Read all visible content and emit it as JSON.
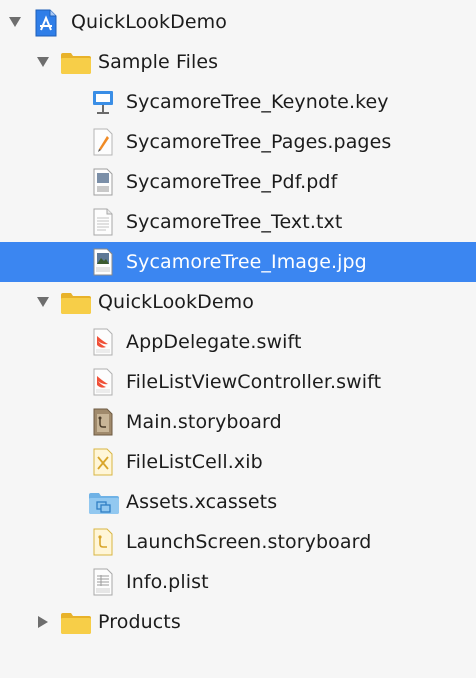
{
  "project": {
    "name": "QuickLookDemo",
    "icon": "xcode-project-icon",
    "expanded": true
  },
  "groups": [
    {
      "name": "Sample Files",
      "icon": "folder-icon",
      "expanded": true,
      "files": [
        {
          "name": "SycamoreTree_Keynote.key",
          "icon": "keynote-file-icon"
        },
        {
          "name": "SycamoreTree_Pages.pages",
          "icon": "pages-file-icon"
        },
        {
          "name": "SycamoreTree_Pdf.pdf",
          "icon": "pdf-file-icon"
        },
        {
          "name": "SycamoreTree_Text.txt",
          "icon": "text-file-icon"
        },
        {
          "name": "SycamoreTree_Image.jpg",
          "icon": "jpeg-file-icon",
          "selected": true
        }
      ]
    },
    {
      "name": "QuickLookDemo",
      "icon": "folder-icon",
      "expanded": true,
      "files": [
        {
          "name": "AppDelegate.swift",
          "icon": "swift-file-icon"
        },
        {
          "name": "FileListViewController.swift",
          "icon": "swift-file-icon"
        },
        {
          "name": "Main.storyboard",
          "icon": "storyboard-file-icon"
        },
        {
          "name": "FileListCell.xib",
          "icon": "xib-file-icon"
        },
        {
          "name": "Assets.xcassets",
          "icon": "assets-folder-icon"
        },
        {
          "name": "LaunchScreen.storyboard",
          "icon": "storyboard-file-icon"
        },
        {
          "name": "Info.plist",
          "icon": "plist-file-icon"
        }
      ]
    },
    {
      "name": "Products",
      "icon": "folder-icon",
      "expanded": false,
      "files": []
    }
  ],
  "colors": {
    "selection": "#3b86f1",
    "folder": "#f7ce48",
    "swift": "#f05138",
    "text": "#1c1c1c"
  }
}
